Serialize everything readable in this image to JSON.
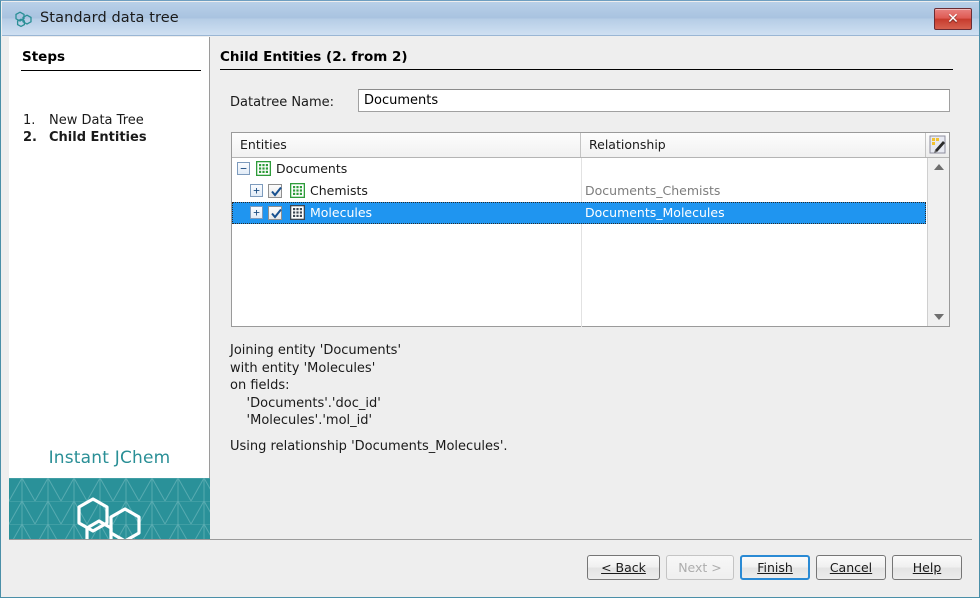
{
  "window": {
    "title": "Standard data tree",
    "icon": "hexagon-cluster-icon",
    "close_label": "✕"
  },
  "sidebar": {
    "heading": "Steps",
    "items": [
      {
        "num": "1.",
        "label": "New Data Tree",
        "active": false
      },
      {
        "num": "2.",
        "label": "Child Entities",
        "active": true
      }
    ],
    "brand": "Instant JChem"
  },
  "main": {
    "panel_title": "Child Entities (2. from 2)",
    "name_label": "Datatree Name:",
    "name_value": "Documents",
    "table": {
      "columns": [
        "Entities",
        "Relationship"
      ],
      "tool_icon": "column-settings-icon",
      "rows": [
        {
          "label": "Documents",
          "relationship": "",
          "indent": 0,
          "expander": "−",
          "checkbox": null,
          "icon": "grid-entity-icon-green",
          "selected": false
        },
        {
          "label": "Chemists",
          "relationship": "Documents_Chemists",
          "indent": 1,
          "expander": "+",
          "checkbox": true,
          "icon": "grid-entity-icon-green",
          "selected": false
        },
        {
          "label": "Molecules",
          "relationship": "Documents_Molecules",
          "indent": 1,
          "expander": "+",
          "checkbox": true,
          "icon": "grid-entity-icon-blue",
          "selected": true
        }
      ]
    },
    "description": "Joining entity 'Documents'\nwith entity 'Molecules'\non fields:\n    'Documents'.'doc_id'\n    'Molecules'.'mol_id'",
    "description2": "Using relationship 'Documents_Molecules'."
  },
  "footer": {
    "back": "< Back",
    "next": "Next >",
    "finish": "Finish",
    "cancel": "Cancel",
    "help": "Help"
  },
  "colors": {
    "titlebar": "#a9c3e0",
    "selection": "#1f95f0",
    "brand_teal": "#2a9199",
    "brand_text": "#2a8f96",
    "focus_border": "#2a8ad4",
    "close_red": "#c63a2d"
  }
}
